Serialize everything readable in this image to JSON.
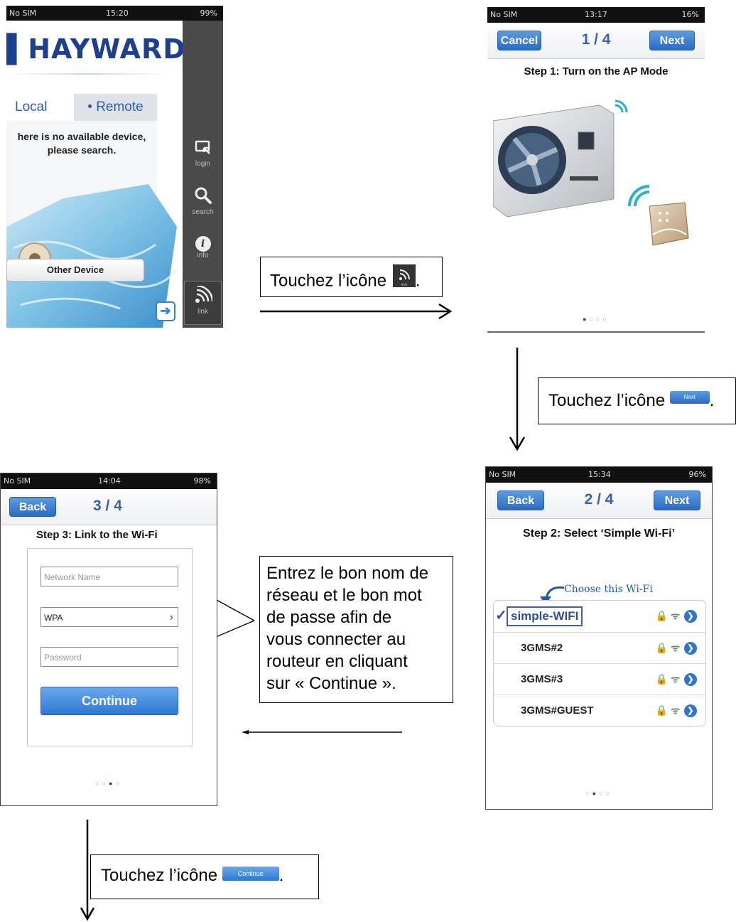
{
  "screen_hayward": {
    "status_left": "No SIM",
    "status_time": "15:20",
    "status_right": "99%",
    "brand": "HAYWARD",
    "tab_local": "Local",
    "tab_remote": "• Remote",
    "message_line1": "here is no available device,",
    "message_line2": "please search.",
    "other_device_label": "Other Device",
    "side_login": "login",
    "side_search": "search",
    "side_info": "info",
    "side_link": "link"
  },
  "callout_link": {
    "text": "Touchez l’icône",
    "suffix": ".",
    "icon_label": "link"
  },
  "screen_step1": {
    "status_left": "No SIM",
    "status_time": "13:17",
    "status_right": "16%",
    "cancel_label": "Cancel",
    "title": "1 / 4",
    "next_label": "Next",
    "step_title": "Step 1: Turn on the AP Mode"
  },
  "callout_next": {
    "text": "Touchez l’icône",
    "suffix": ".",
    "icon_label": "Next"
  },
  "screen_step2": {
    "status_left": "No SIM",
    "status_time": "15:34",
    "status_right": "96%",
    "back_label": "Back",
    "title": "2 / 4",
    "next_label": "Next",
    "step_title": "Step 2: Select ‘Simple Wi-Fi’",
    "choose_label": "Choose this Wi-Fi",
    "networks": [
      "simple-WIFI",
      "3GMS#2",
      "3GMS#3",
      "3GMS#GUEST"
    ]
  },
  "callout_network": {
    "lines": [
      "Entrez le bon nom de",
      "réseau et le bon mot",
      "de passe afin de",
      "vous connecter au",
      "routeur en cliquant",
      "sur « Continue »."
    ]
  },
  "screen_step3": {
    "status_left": "No SIM",
    "status_time": "14:04",
    "status_right": "98%",
    "back_label": "Back",
    "title": "3 / 4",
    "step_title": "Step 3: Link to the Wi-Fi",
    "network_placeholder": "Network Name",
    "security_value": "WPA",
    "password_placeholder": "Password",
    "continue_label": "Continue"
  },
  "callout_continue": {
    "text": "Touchez l’icône",
    "suffix": ".",
    "icon_label": "Continue"
  }
}
